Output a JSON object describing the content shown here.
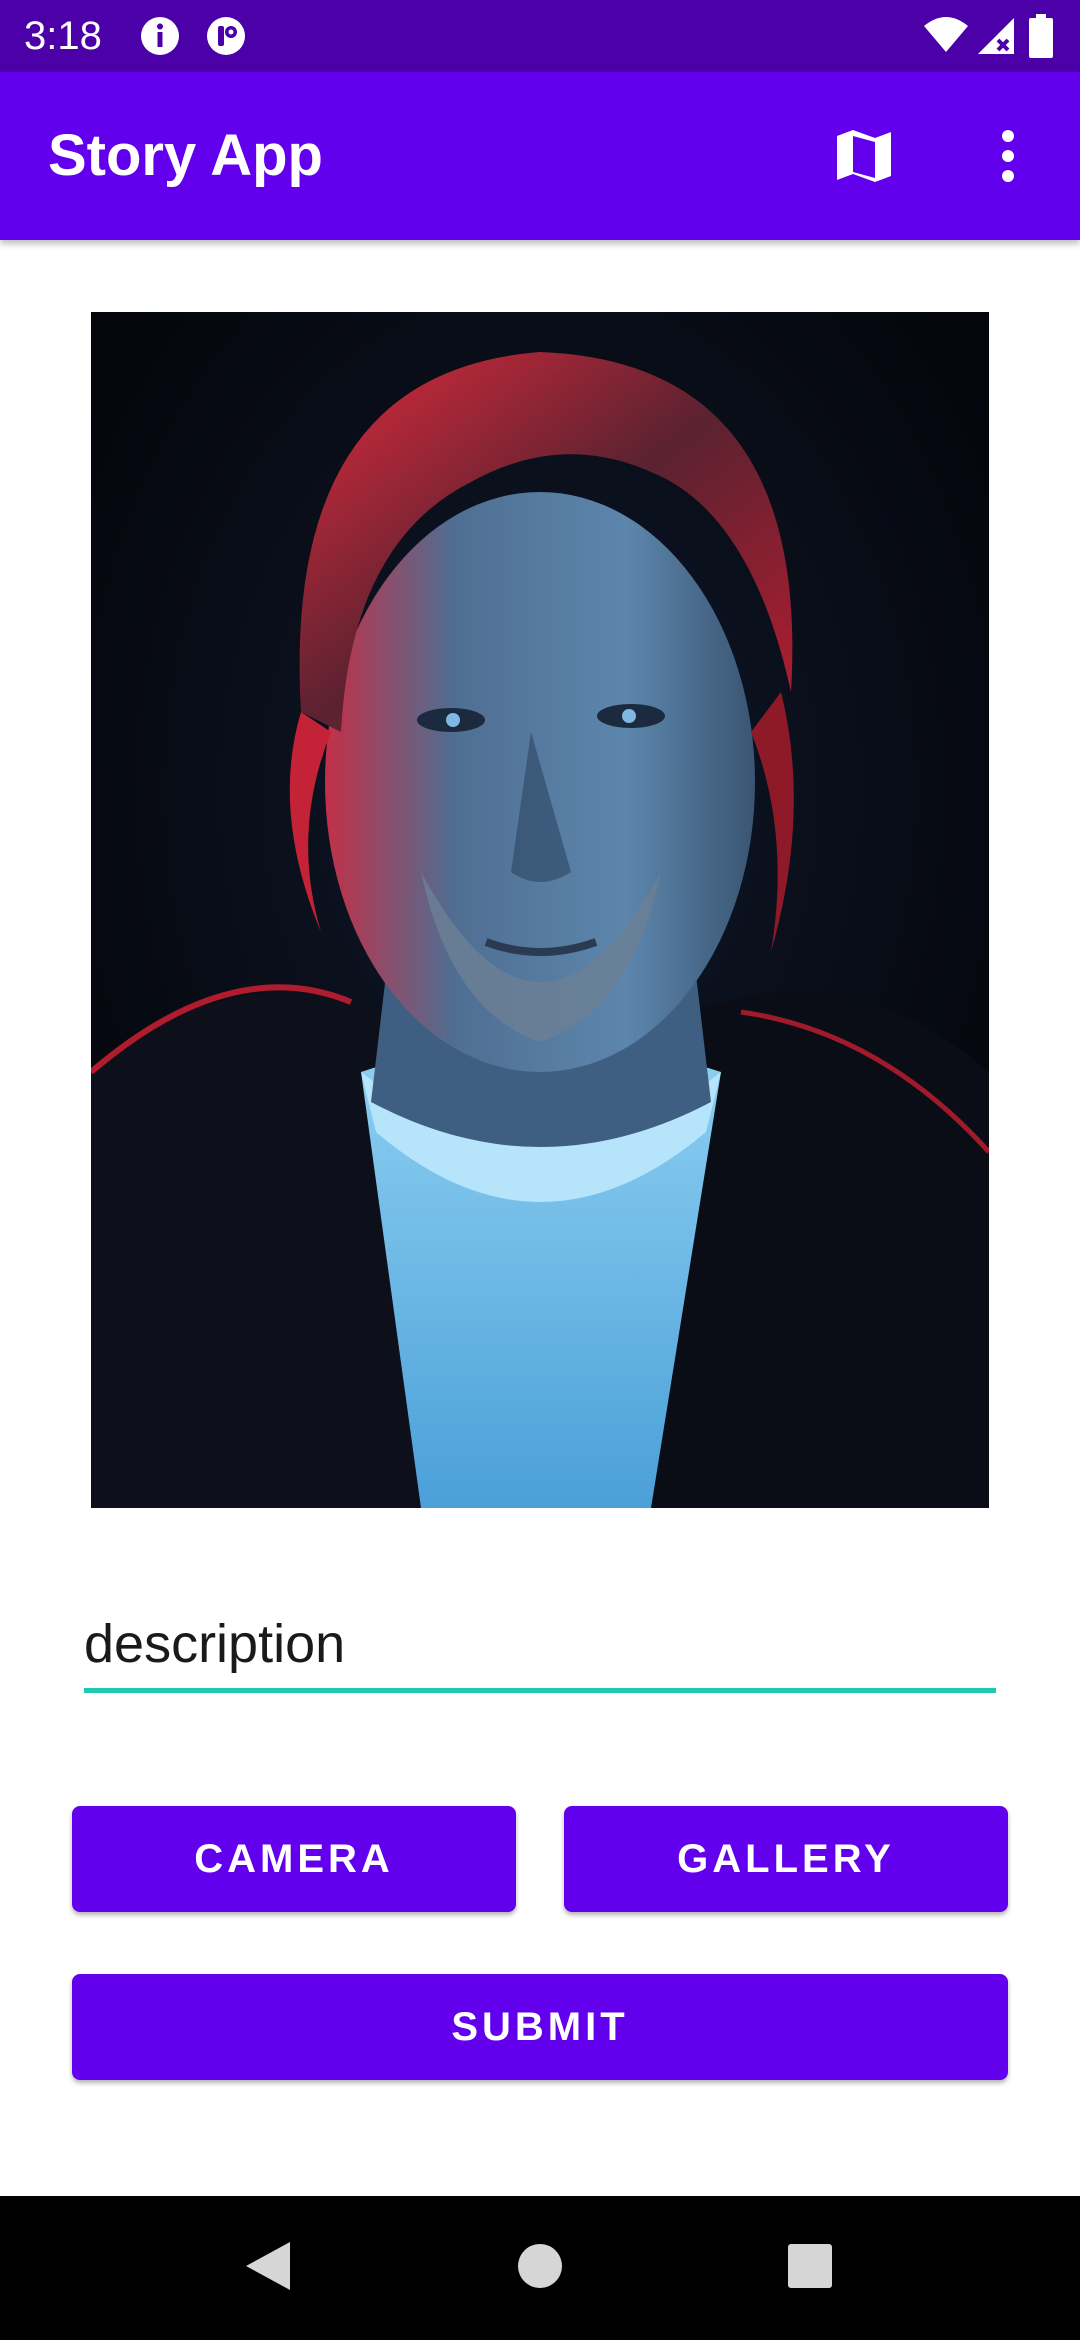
{
  "status_bar": {
    "time": "3:18",
    "icons": [
      "info-icon",
      "app-notification-icon",
      "wifi-icon",
      "cell-signal-no-data-icon",
      "battery-icon"
    ]
  },
  "app_bar": {
    "title": "Story App",
    "actions": [
      "map-icon",
      "more-vert-icon"
    ],
    "background": "#6200ee"
  },
  "story_photo": {
    "description": "photo-preview"
  },
  "description_field": {
    "placeholder": "description",
    "value": "",
    "underline_color": "#20c9b6"
  },
  "buttons": {
    "camera_label": "CAMERA",
    "gallery_label": "GALLERY",
    "submit_label": "SUBMIT",
    "color": "#6200ee"
  },
  "nav_bar": {
    "icons": [
      "back-icon",
      "home-icon",
      "recents-icon"
    ]
  }
}
